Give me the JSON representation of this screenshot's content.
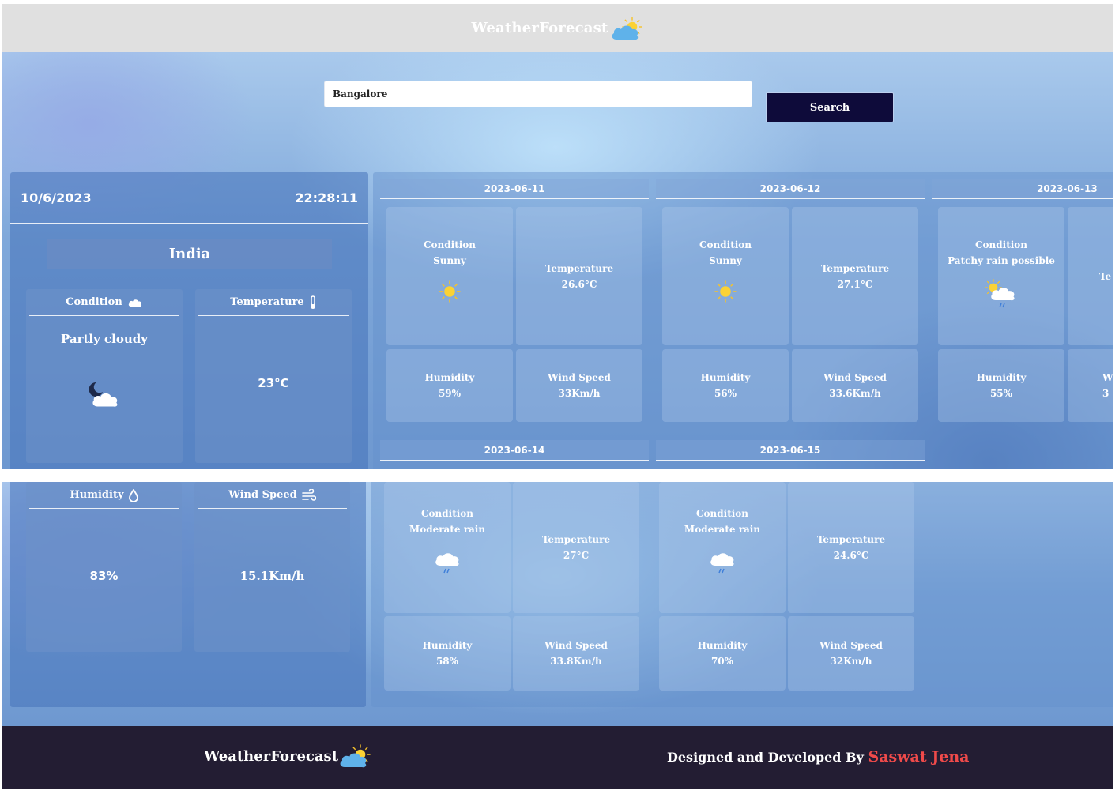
{
  "header": {
    "brand_label": "WeatherForecast",
    "logo_icon": "sun-cloud-icon"
  },
  "search": {
    "value": "Bangalore",
    "button_label": "Search"
  },
  "current": {
    "date": "10/6/2023",
    "time": "22:28:11",
    "country": "India",
    "condition": {
      "label": "Condition",
      "icon": "cloud-icon",
      "value": "Partly cloudy",
      "value_icon": "moon-cloud-icon"
    },
    "temperature": {
      "label": "Temperature",
      "icon": "thermometer-icon",
      "value": "23°C"
    },
    "humidity": {
      "label": "Humidity",
      "icon": "droplet-icon",
      "value": "83%"
    },
    "wind": {
      "label": "Wind Speed",
      "icon": "wind-icon",
      "value": "15.1Km/h"
    }
  },
  "forecast": [
    {
      "date": "2023-06-11",
      "condition_label": "Condition",
      "condition": "Sunny",
      "icon": "sun-icon",
      "temp_label": "Temperature",
      "temperature": "26.6°C",
      "humidity_label": "Humidity",
      "humidity": "59%",
      "wind_label": "Wind Speed",
      "wind": "33Km/h"
    },
    {
      "date": "2023-06-12",
      "condition_label": "Condition",
      "condition": "Sunny",
      "icon": "sun-icon",
      "temp_label": "Temperature",
      "temperature": "27.1°C",
      "humidity_label": "Humidity",
      "humidity": "56%",
      "wind_label": "Wind Speed",
      "wind": "33.6Km/h"
    },
    {
      "date": "2023-06-13",
      "condition_label": "Condition",
      "condition": "Patchy rain possible",
      "icon": "sun-rain-cloud-icon",
      "temp_label": "Te",
      "humidity_label": "Humidity",
      "humidity": "55%",
      "wind_label": "W",
      "wind": "3"
    },
    {
      "date": "2023-06-14",
      "condition_label": "Condition",
      "condition": "Moderate rain",
      "icon": "rain-cloud-icon",
      "temp_label": "Temperature",
      "temperature": "27°C",
      "humidity_label": "Humidity",
      "humidity": "58%",
      "wind_label": "Wind Speed",
      "wind": "33.8Km/h"
    },
    {
      "date": "2023-06-15",
      "condition_label": "Condition",
      "condition": "Moderate rain",
      "icon": "rain-cloud-icon",
      "temp_label": "Temperature",
      "temperature": "24.6°C",
      "humidity_label": "Humidity",
      "humidity": "70%",
      "wind_label": "Wind Speed",
      "wind": "32Km/h"
    }
  ],
  "footer": {
    "brand_label": "WeatherForecast",
    "credit_prefix": "Designed and Developed By",
    "author": "Saswat Jena"
  },
  "colors": {
    "search_button": "#0e0b3a",
    "footer_bg": "#231d33",
    "author": "#ef4a4a",
    "header_bg": "#e0e0e0"
  }
}
